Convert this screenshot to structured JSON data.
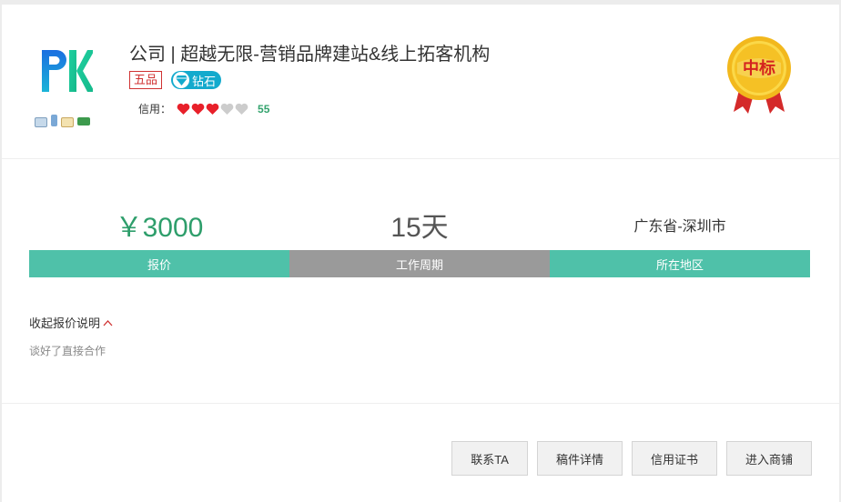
{
  "company": {
    "title": "公司 | 超越无限-营销品牌建站&线上拓客机构",
    "grade": "五品",
    "level": "钻石",
    "credit_label": "信用：",
    "credit_hearts_filled": 3,
    "credit_hearts_total": 5,
    "credit_score": "55",
    "medal_text": "中标"
  },
  "stats": {
    "price": "￥3000",
    "price_label": "报价",
    "period": "15天",
    "period_label": "工作周期",
    "region": "广东省-深圳市",
    "region_label": "所在地区"
  },
  "quote": {
    "toggle_label": "收起报价说明",
    "description": "谈好了直接合作"
  },
  "actions": {
    "contact": "联系TA",
    "details": "稿件详情",
    "certificate": "信用证书",
    "shop": "进入商铺"
  },
  "colors": {
    "accent_green": "#4fc1a9",
    "price_green": "#2e9e6b",
    "grade_red": "#d03232",
    "diamond_blue": "#13aacd"
  }
}
